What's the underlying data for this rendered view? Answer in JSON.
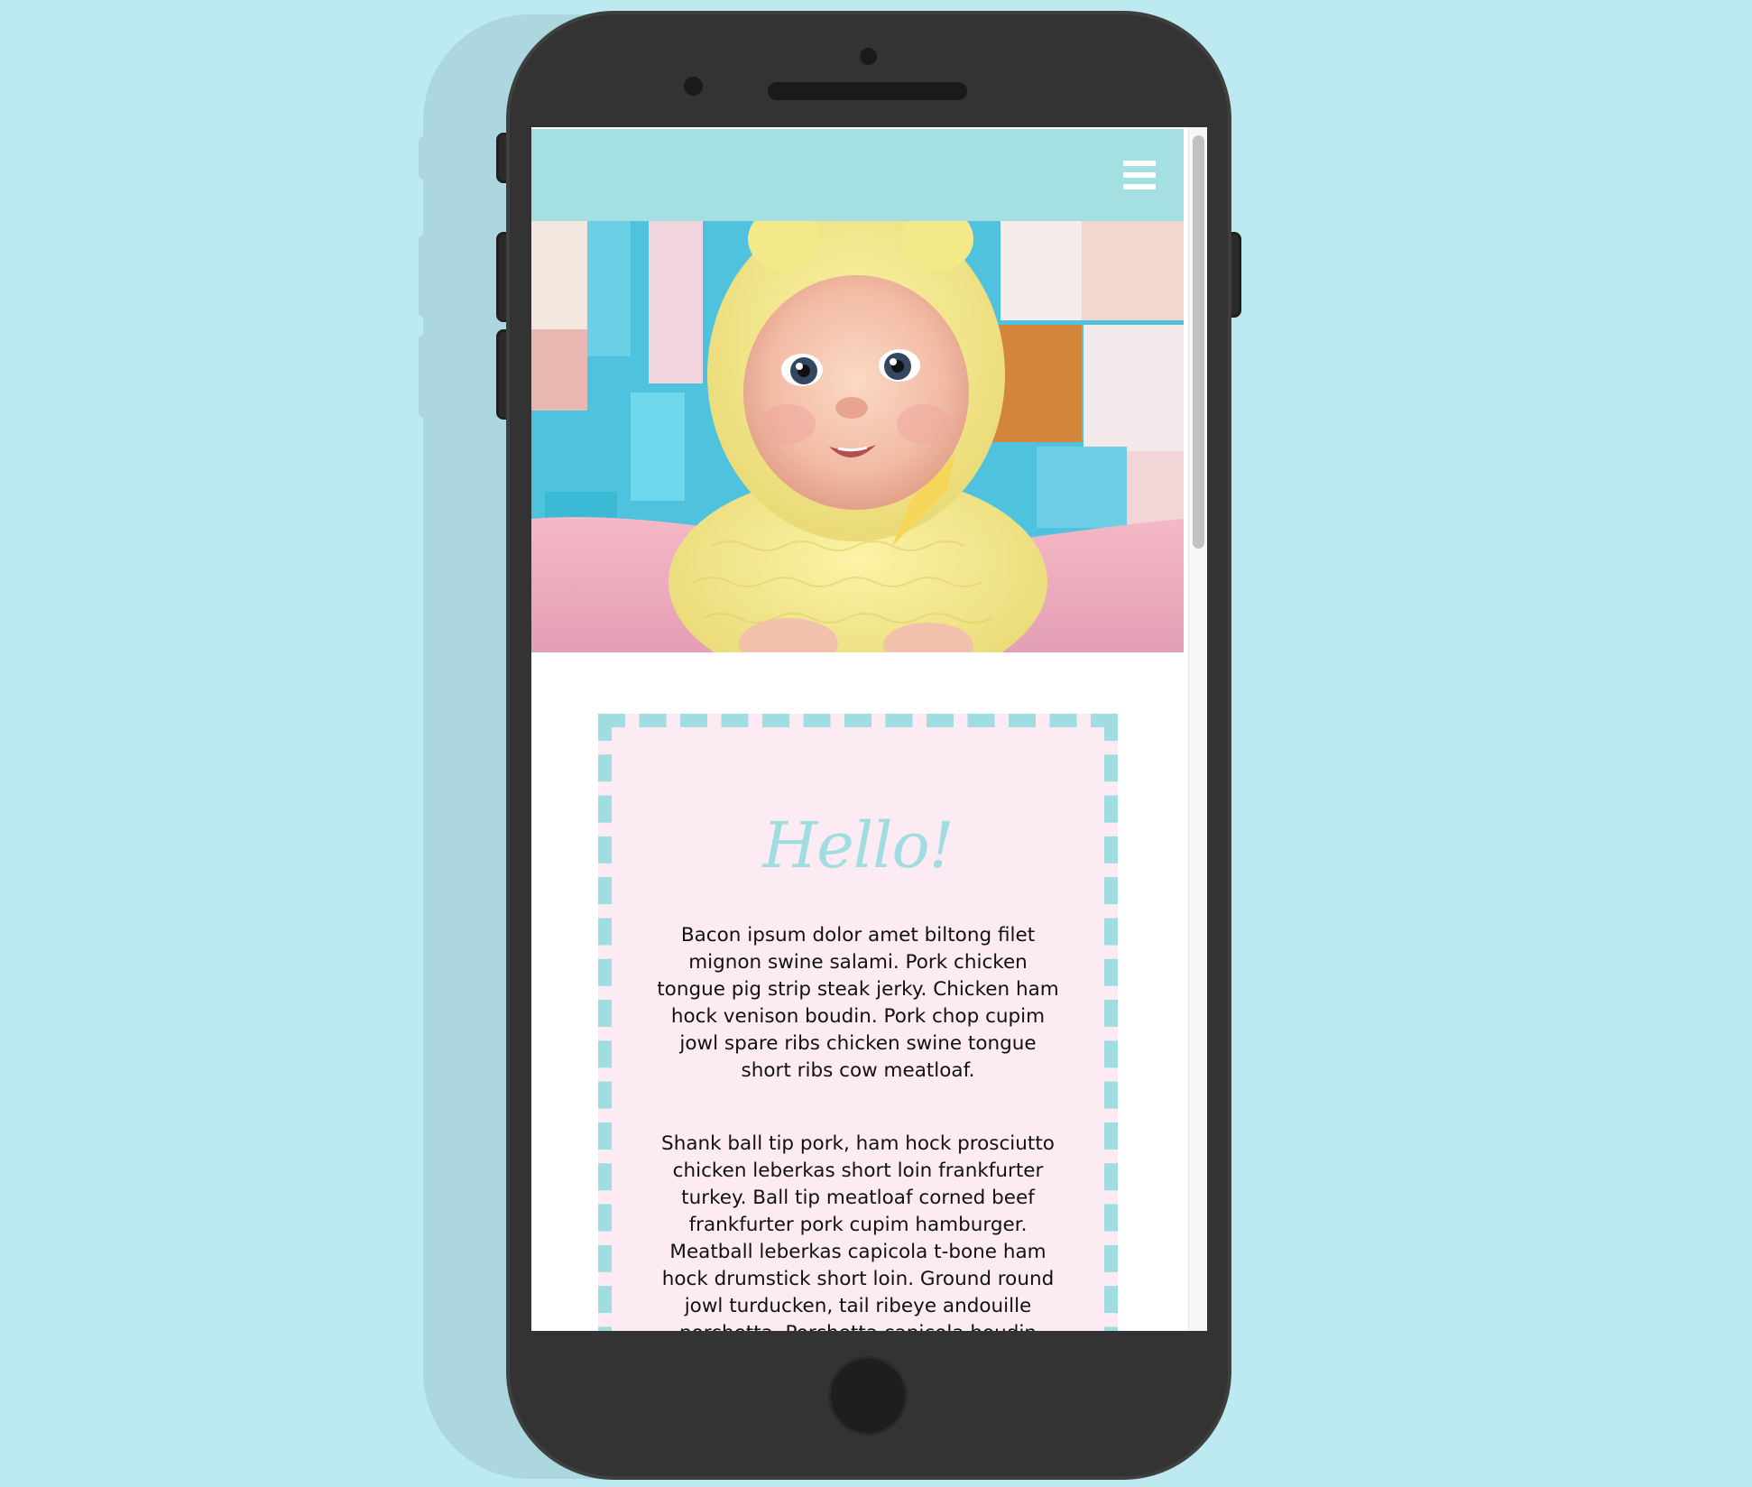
{
  "colors": {
    "page_background": "#bde9f1",
    "phone_body": "#333333",
    "header_background": "#a4e0e1",
    "card_background": "#fdebf4",
    "card_border": "#a0dde0",
    "title_color": "#a0dde0"
  },
  "header": {
    "menu_icon": "hamburger-menu-icon"
  },
  "hero": {
    "image": "baby-photo"
  },
  "card": {
    "title": "Hello!",
    "paragraph_1": "Bacon ipsum dolor amet biltong filet mignon swine salami. Pork chicken tongue pig strip steak jerky. Chicken ham hock venison boudin. Pork chop cupim jowl spare ribs chicken swine tongue short ribs cow meatloaf.",
    "paragraph_2": "Shank ball tip pork, ham hock prosciutto chicken leberkas short loin frankfurter turkey. Ball tip meatloaf corned beef frankfurter pork cupim hamburger. Meatball leberkas capicola t-bone ham hock drumstick short loin. Ground round jowl turducken, tail ribeye andouille porchetta. Porchetta capicola boudin sausage salami."
  }
}
